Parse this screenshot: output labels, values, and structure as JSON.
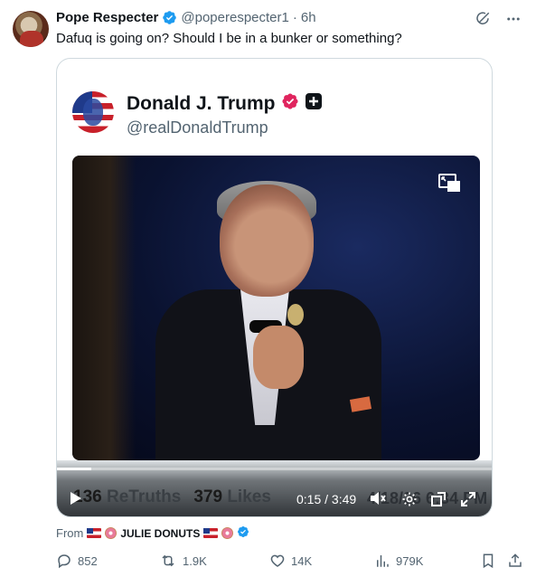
{
  "post": {
    "author_name": "Pope Respecter",
    "handle": "@poperespecter1",
    "separator": "·",
    "time_ago": "6h",
    "text": "Dafuq is going on? Should I be in a bunker or something?"
  },
  "embed": {
    "author_name": "Donald J. Trump",
    "handle": "@realDonaldTrump",
    "video": {
      "elapsed": "0:15",
      "time_separator": "/",
      "duration": "3:49",
      "progress": 0.08
    },
    "stats": {
      "retruths_count": "136",
      "retruths_label": "ReTruths",
      "likes_count": "379",
      "likes_label": "Likes",
      "datetime": "4/18/26 6:34 PM"
    }
  },
  "source": {
    "prefix": "From",
    "account_name": "JULIE DONUTS"
  },
  "actions": {
    "replies": "852",
    "reposts": "1.9K",
    "likes": "14K",
    "views": "979K"
  },
  "icons": {
    "verified": "verified-badge-icon",
    "grok": "grok-icon",
    "more": "more-icon",
    "truth_badge": "truth-verified-icon",
    "plus": "plus-icon",
    "pip": "picture-in-picture-icon",
    "play": "play-icon",
    "volume": "volume-icon",
    "settings": "settings-icon",
    "fullscreen": "fullscreen-icon",
    "expand": "expand-icon",
    "reply": "reply-icon",
    "repost": "repost-icon",
    "like": "heart-icon",
    "views": "views-icon",
    "bookmark": "bookmark-icon",
    "share": "share-icon"
  },
  "colors": {
    "verified_blue": "#1d9bf0",
    "truth_pink": "#e0245e",
    "secondary_text": "#536471",
    "primary_text": "#0f1419"
  }
}
